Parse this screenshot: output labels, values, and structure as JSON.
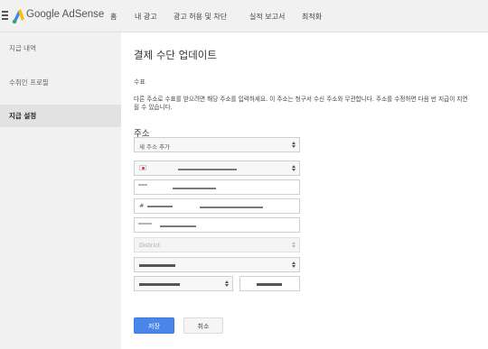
{
  "app": {
    "brand": "Google AdSense"
  },
  "nav": [
    "홈",
    "내 광고",
    "광고 허용 및 차단",
    "실적 보고서",
    "최적화"
  ],
  "sidebar": [
    "지급 내역",
    "수취인 프로필",
    "지급 설정"
  ],
  "main": {
    "title": "결제 수단 업데이트",
    "section_label": "수표",
    "description": "다른 주소로 수표를 받으려면 해당 주소를 입력하세요. 이 주소는 청구서 수신 주소와 무관합니다. 주소를 수정하면 다음 번 지급이 지연될 수 있습니다.",
    "address_heading": "주소",
    "address_select_value": "새 주소 추가",
    "district_placeholder": "District"
  },
  "buttons": {
    "save": "저장",
    "cancel": "취소"
  },
  "colors": {
    "primary": "#4a86e8",
    "sidebar_bg": "#f1f1f1",
    "active_bg": "#e2e2e2"
  }
}
